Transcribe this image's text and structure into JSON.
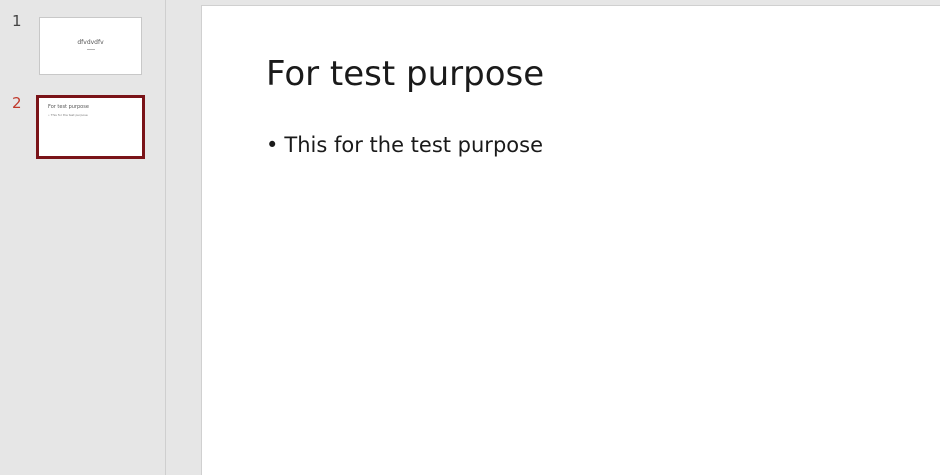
{
  "thumbnails": [
    {
      "number": "1",
      "title": "dfvdvdfv",
      "subtitle": "",
      "selected": false
    },
    {
      "number": "2",
      "title": "For test purpose",
      "bullet": "This for the test purpose",
      "selected": true
    }
  ],
  "current_slide": {
    "title": "For test purpose",
    "bullet_char": "•",
    "bullet": "This for the test purpose"
  },
  "colors": {
    "selection_border": "#7a1318",
    "active_number": "#c0392b"
  }
}
